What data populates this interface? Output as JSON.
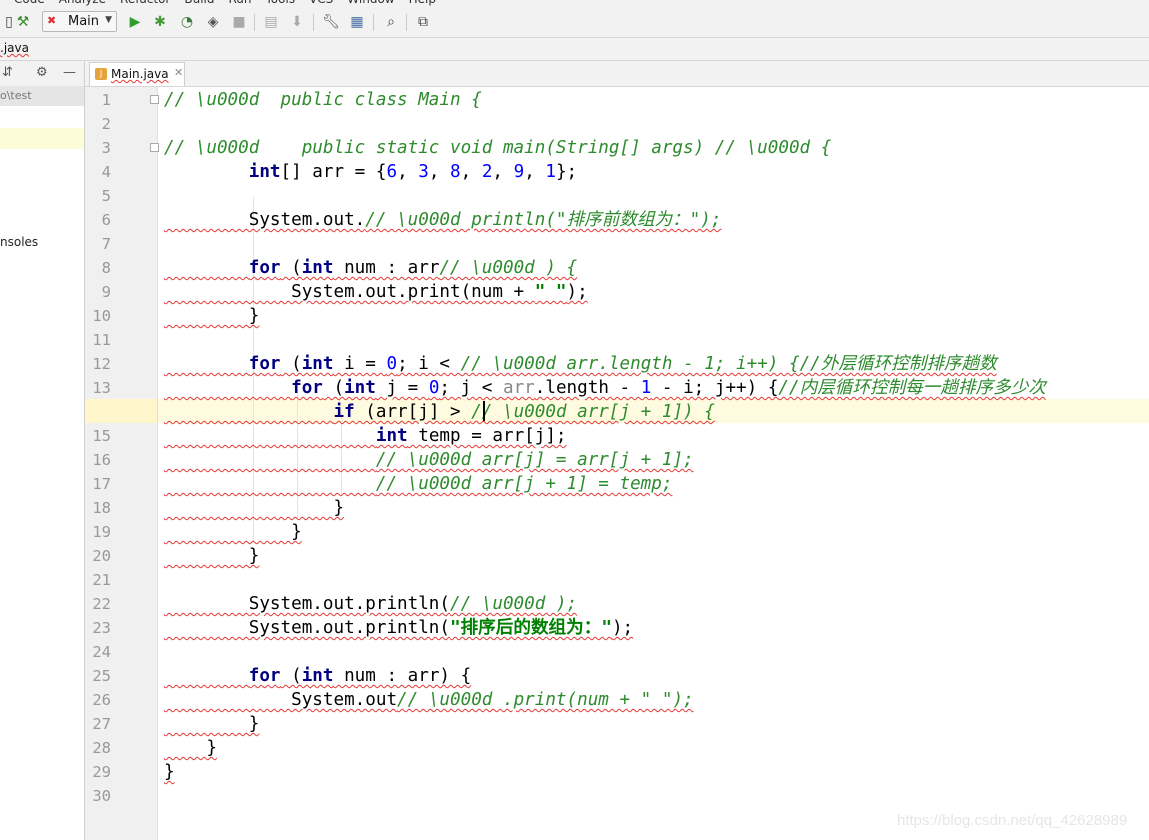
{
  "menubar": {
    "items": [
      "Code",
      "Analyze",
      "Refactor",
      "Build",
      "Run",
      "Tools",
      "VCS",
      "Window",
      "Help"
    ]
  },
  "toolbar": {
    "run_config": "Main",
    "icons": [
      "build-hammer-icon",
      "run-icon",
      "debug-icon",
      "coverage-icon",
      "profile-icon",
      "stop-icon",
      "vcs-update-icon",
      "vcs-commit-icon",
      "settings-wrench-icon",
      "project-structure-icon",
      "search-icon",
      "sdk-icon"
    ]
  },
  "navbar": {
    "breadcrumb": ".java"
  },
  "project_panel": {
    "path": "o\\test",
    "consoles_label": "nsoles"
  },
  "editor": {
    "tab_label": "Main.java",
    "current_line": 14,
    "lines": [
      {
        "n": "1",
        "parts": [
          {
            "c": "cm",
            "t": "// \\u000d  public class Main {"
          }
        ]
      },
      {
        "n": "2",
        "parts": []
      },
      {
        "n": "3",
        "parts": [
          {
            "c": "cm",
            "t": "// \\u000d    public static void main(String[] args) // \\u000d {"
          }
        ]
      },
      {
        "n": "4",
        "parts": [
          {
            "c": "",
            "t": "        "
          },
          {
            "c": "kw",
            "t": "int"
          },
          {
            "c": "",
            "t": "[] arr = {"
          },
          {
            "c": "num",
            "t": "6"
          },
          {
            "c": "",
            "t": ", "
          },
          {
            "c": "num",
            "t": "3"
          },
          {
            "c": "",
            "t": ", "
          },
          {
            "c": "num",
            "t": "8"
          },
          {
            "c": "",
            "t": ", "
          },
          {
            "c": "num",
            "t": "2"
          },
          {
            "c": "",
            "t": ", "
          },
          {
            "c": "num",
            "t": "9"
          },
          {
            "c": "",
            "t": ", "
          },
          {
            "c": "num",
            "t": "1"
          },
          {
            "c": "",
            "t": "};"
          }
        ]
      },
      {
        "n": "5",
        "parts": []
      },
      {
        "n": "6",
        "sq": true,
        "parts": [
          {
            "c": "",
            "t": "        System.out."
          },
          {
            "c": "cm",
            "t": "// \\u000d println(\"排序前数组为：\");"
          }
        ]
      },
      {
        "n": "7",
        "parts": []
      },
      {
        "n": "8",
        "sq": true,
        "parts": [
          {
            "c": "",
            "t": "        "
          },
          {
            "c": "kw",
            "t": "for"
          },
          {
            "c": "",
            "t": " ("
          },
          {
            "c": "kw",
            "t": "int"
          },
          {
            "c": "",
            "t": " num : arr"
          },
          {
            "c": "cm",
            "t": "// \\u000d ) {"
          }
        ]
      },
      {
        "n": "9",
        "sq": true,
        "parts": [
          {
            "c": "",
            "t": "            System.out.print(num + "
          },
          {
            "c": "str",
            "t": "\" \""
          },
          {
            "c": "",
            "t": ");"
          }
        ]
      },
      {
        "n": "10",
        "sq": true,
        "parts": [
          {
            "c": "",
            "t": "        }"
          }
        ]
      },
      {
        "n": "11",
        "parts": []
      },
      {
        "n": "12",
        "sq": true,
        "parts": [
          {
            "c": "",
            "t": "        "
          },
          {
            "c": "kw",
            "t": "for"
          },
          {
            "c": "",
            "t": " ("
          },
          {
            "c": "kw",
            "t": "int"
          },
          {
            "c": "",
            "t": " i = "
          },
          {
            "c": "num",
            "t": "0"
          },
          {
            "c": "",
            "t": "; i < "
          },
          {
            "c": "cm",
            "t": "// \\u000d arr.length - 1; i++) {//外层循环控制排序趟数"
          }
        ]
      },
      {
        "n": "13",
        "sq": true,
        "parts": [
          {
            "c": "",
            "t": "            "
          },
          {
            "c": "kw",
            "t": "for"
          },
          {
            "c": "",
            "t": " ("
          },
          {
            "c": "kw",
            "t": "int"
          },
          {
            "c": "",
            "t": " j = "
          },
          {
            "c": "num",
            "t": "0"
          },
          {
            "c": "",
            "t": "; j < "
          },
          {
            "c": "gr",
            "t": "arr"
          },
          {
            "c": "",
            "t": ".length - "
          },
          {
            "c": "num",
            "t": "1"
          },
          {
            "c": "",
            "t": " - i; j++) {"
          },
          {
            "c": "cm",
            "t": "//内层循环控制每一趟排序多少次"
          }
        ]
      },
      {
        "n": "14",
        "sq": true,
        "parts": [
          {
            "c": "",
            "t": "                "
          },
          {
            "c": "kw",
            "t": "if"
          },
          {
            "c": "",
            "t": " (arr[j] > "
          },
          {
            "c": "cm",
            "t": "// \\u000d arr[j + 1]) {"
          }
        ]
      },
      {
        "n": "15",
        "sq": true,
        "parts": [
          {
            "c": "",
            "t": "                    "
          },
          {
            "c": "kw",
            "t": "int"
          },
          {
            "c": "",
            "t": " temp = arr[j];"
          }
        ]
      },
      {
        "n": "16",
        "sq": true,
        "parts": [
          {
            "c": "",
            "t": "                    "
          },
          {
            "c": "cm",
            "t": "// \\u000d arr[j] = arr[j + 1];"
          }
        ]
      },
      {
        "n": "17",
        "sq": true,
        "parts": [
          {
            "c": "",
            "t": "                    "
          },
          {
            "c": "cm",
            "t": "// \\u000d arr[j + 1] = temp;"
          }
        ]
      },
      {
        "n": "18",
        "sq": true,
        "parts": [
          {
            "c": "",
            "t": "                }"
          }
        ]
      },
      {
        "n": "19",
        "sq": true,
        "parts": [
          {
            "c": "",
            "t": "            }"
          }
        ]
      },
      {
        "n": "20",
        "sq": true,
        "parts": [
          {
            "c": "",
            "t": "        }"
          }
        ]
      },
      {
        "n": "21",
        "parts": []
      },
      {
        "n": "22",
        "sq": true,
        "parts": [
          {
            "c": "",
            "t": "        System.out.println("
          },
          {
            "c": "cm",
            "t": "// \\u000d );"
          }
        ]
      },
      {
        "n": "23",
        "sq": true,
        "parts": [
          {
            "c": "",
            "t": "        System.out.println("
          },
          {
            "c": "str",
            "t": "\"排序后的数组为：\""
          },
          {
            "c": "",
            "t": ");"
          }
        ]
      },
      {
        "n": "24",
        "parts": []
      },
      {
        "n": "25",
        "sq": true,
        "parts": [
          {
            "c": "",
            "t": "        "
          },
          {
            "c": "kw",
            "t": "for"
          },
          {
            "c": "",
            "t": " ("
          },
          {
            "c": "kw",
            "t": "int"
          },
          {
            "c": "",
            "t": " num : arr) {"
          }
        ]
      },
      {
        "n": "26",
        "sq": true,
        "parts": [
          {
            "c": "",
            "t": "            System.out"
          },
          {
            "c": "cm",
            "t": "// \\u000d .print(num + \" \");"
          }
        ]
      },
      {
        "n": "27",
        "sq": true,
        "parts": [
          {
            "c": "",
            "t": "        }"
          }
        ]
      },
      {
        "n": "28",
        "sq": true,
        "parts": [
          {
            "c": "",
            "t": "    }"
          }
        ]
      },
      {
        "n": "29",
        "sq": true,
        "parts": [
          {
            "c": "",
            "t": "}"
          }
        ]
      },
      {
        "n": "30",
        "parts": []
      }
    ]
  },
  "watermark": "https://blog.csdn.net/qq_42628989",
  "colors": {
    "keyword": "#000080",
    "number": "#0000ff",
    "comment": "#2e8b2e",
    "string": "#008000",
    "error_underline": "#e53935",
    "caret_line": "#fffbe0"
  }
}
